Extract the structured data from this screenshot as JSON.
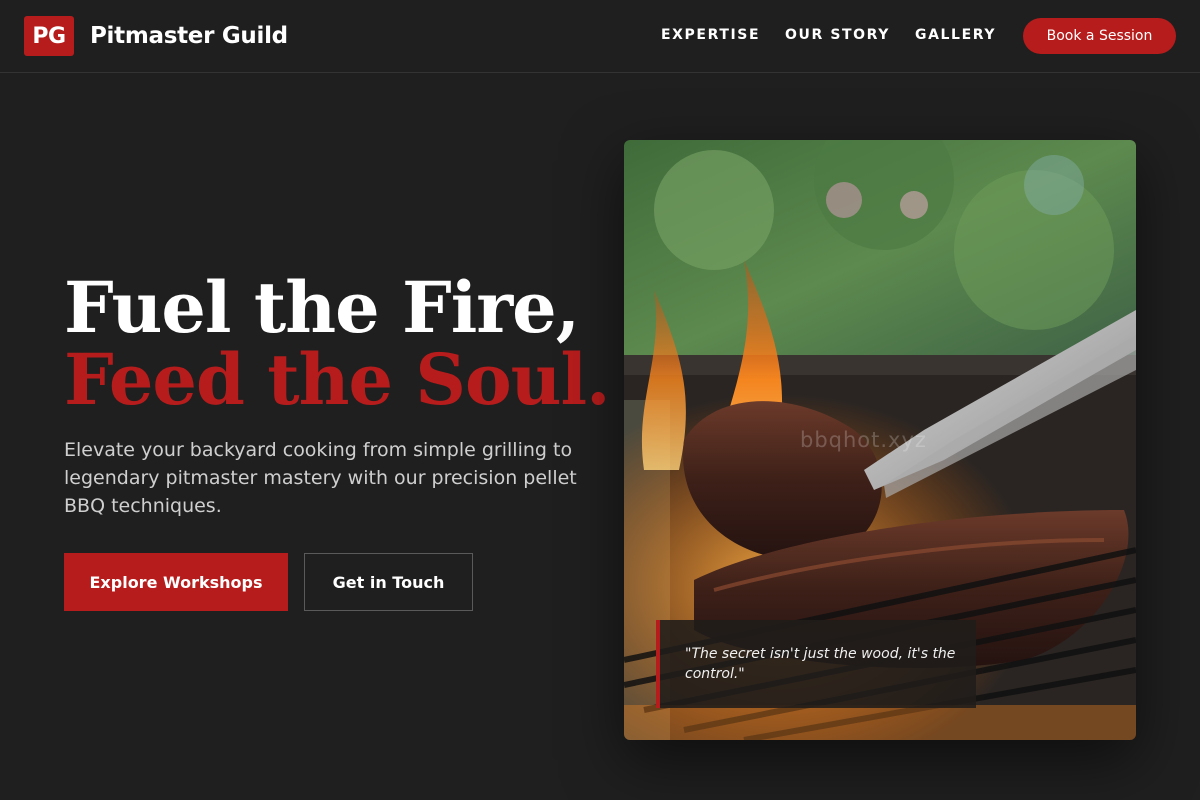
{
  "brand": {
    "logo_text": "PG",
    "name": "Pitmaster Guild"
  },
  "nav": {
    "items": [
      "EXPERTISE",
      "OUR STORY",
      "GALLERY"
    ],
    "cta_label": "Book a Session"
  },
  "hero": {
    "title_line1": "Fuel the Fire,",
    "title_line2": "Feed the Soul.",
    "description": "Elevate your backyard cooking from simple grilling to legendary pitmaster mastery with our precision pellet BBQ techniques.",
    "primary_button": "Explore Workshops",
    "secondary_button": "Get in Touch"
  },
  "image_card": {
    "watermark": "bbqhot.xyz",
    "quote": "\"The secret isn't just the wood, it's the control.\""
  },
  "colors": {
    "accent": "#b71c1c",
    "background": "#1f1f1f"
  }
}
